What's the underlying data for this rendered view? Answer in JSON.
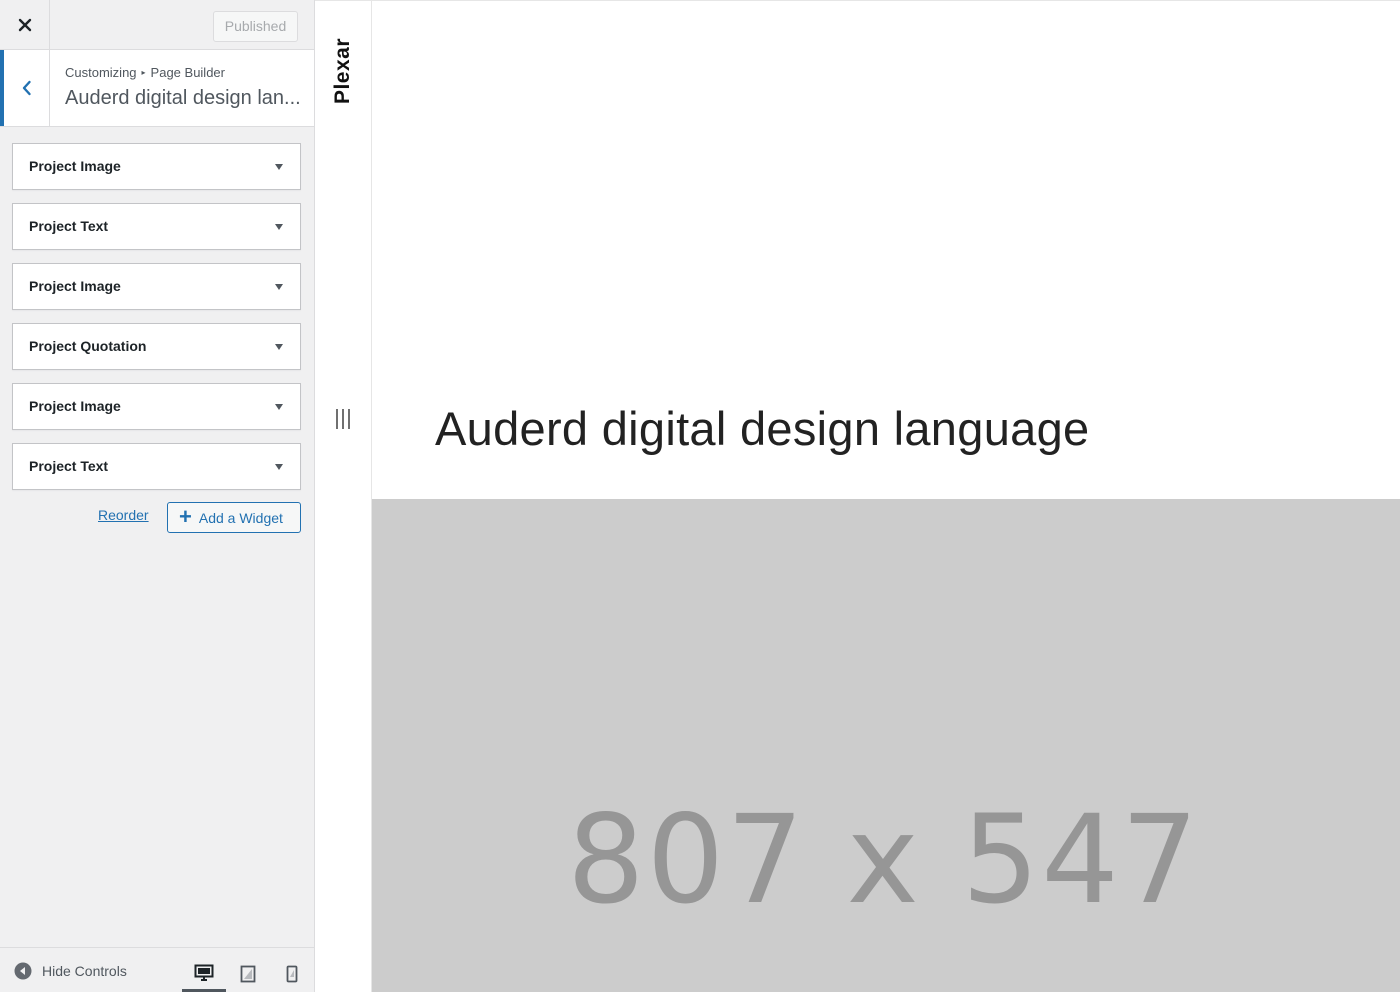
{
  "sidebar": {
    "header": {
      "published_label": "Published"
    },
    "section": {
      "breadcrumb_root": "Customizing",
      "breadcrumb_separator": "▸",
      "breadcrumb_current": "Page Builder",
      "title": "Auderd digital design lan..."
    },
    "widgets": [
      {
        "label": "Project Image"
      },
      {
        "label": "Project Text"
      },
      {
        "label": "Project Image"
      },
      {
        "label": "Project Quotation"
      },
      {
        "label": "Project Image"
      },
      {
        "label": "Project Text"
      }
    ],
    "reorder_label": "Reorder",
    "add_widget_label": "Add a Widget",
    "footer": {
      "hide_controls_label": "Hide Controls",
      "devices": [
        "desktop",
        "tablet",
        "mobile"
      ],
      "active_device": "desktop"
    }
  },
  "preview": {
    "site_name": "Plexar",
    "page_title": "Auderd digital design language",
    "placeholder_text": "807 x 547"
  },
  "colors": {
    "accent": "#2271b1",
    "sidebar_bg": "#f0f0f1",
    "placeholder_bg": "#cccccc",
    "placeholder_text": "#969696"
  }
}
